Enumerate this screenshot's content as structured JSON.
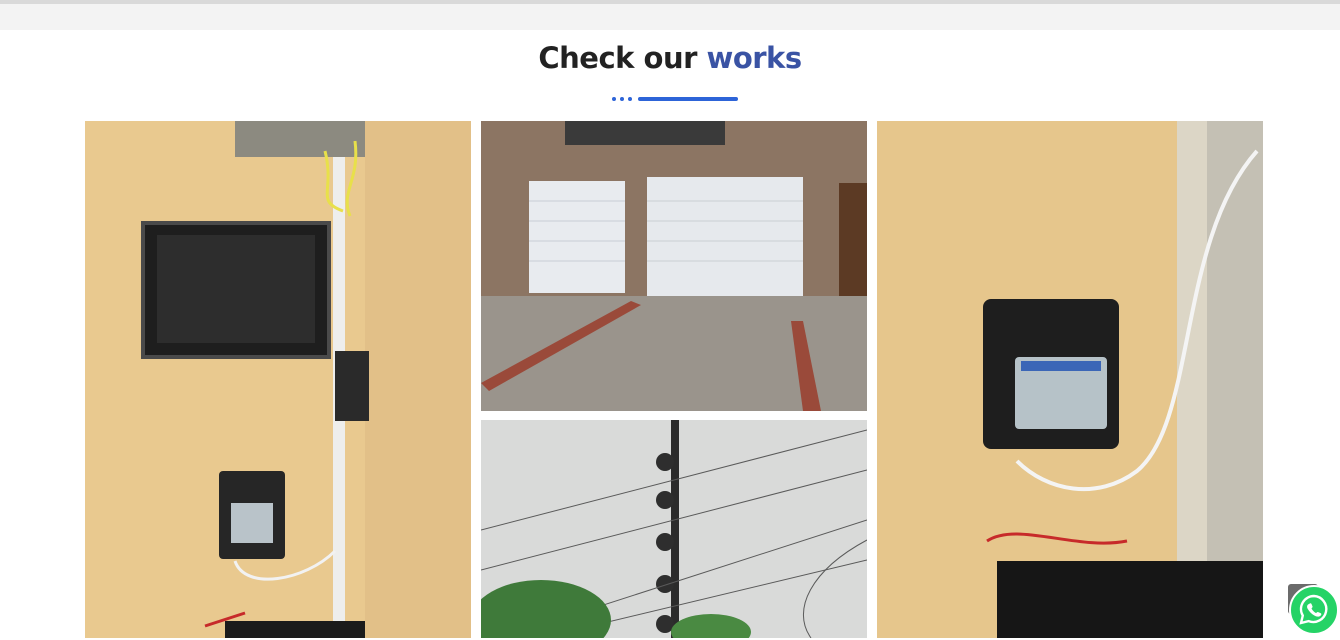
{
  "section": {
    "heading_plain": "Check our",
    "heading_accent": "works",
    "accent_color": "#3a53a4",
    "divider_color": "#2d64d8"
  },
  "gallery": [
    {
      "icon": "electric-fence-energizer-with-monitor-photo"
    },
    {
      "icon": "garage-roller-shutters-photo"
    },
    {
      "icon": "electric-fence-insulators-photo"
    },
    {
      "icon": "wizord-4-energizer-photo"
    }
  ],
  "floating": {
    "scroll_top_icon": "arrow-up-icon",
    "whatsapp_icon": "whatsapp-icon",
    "whatsapp_color": "#25d366"
  }
}
